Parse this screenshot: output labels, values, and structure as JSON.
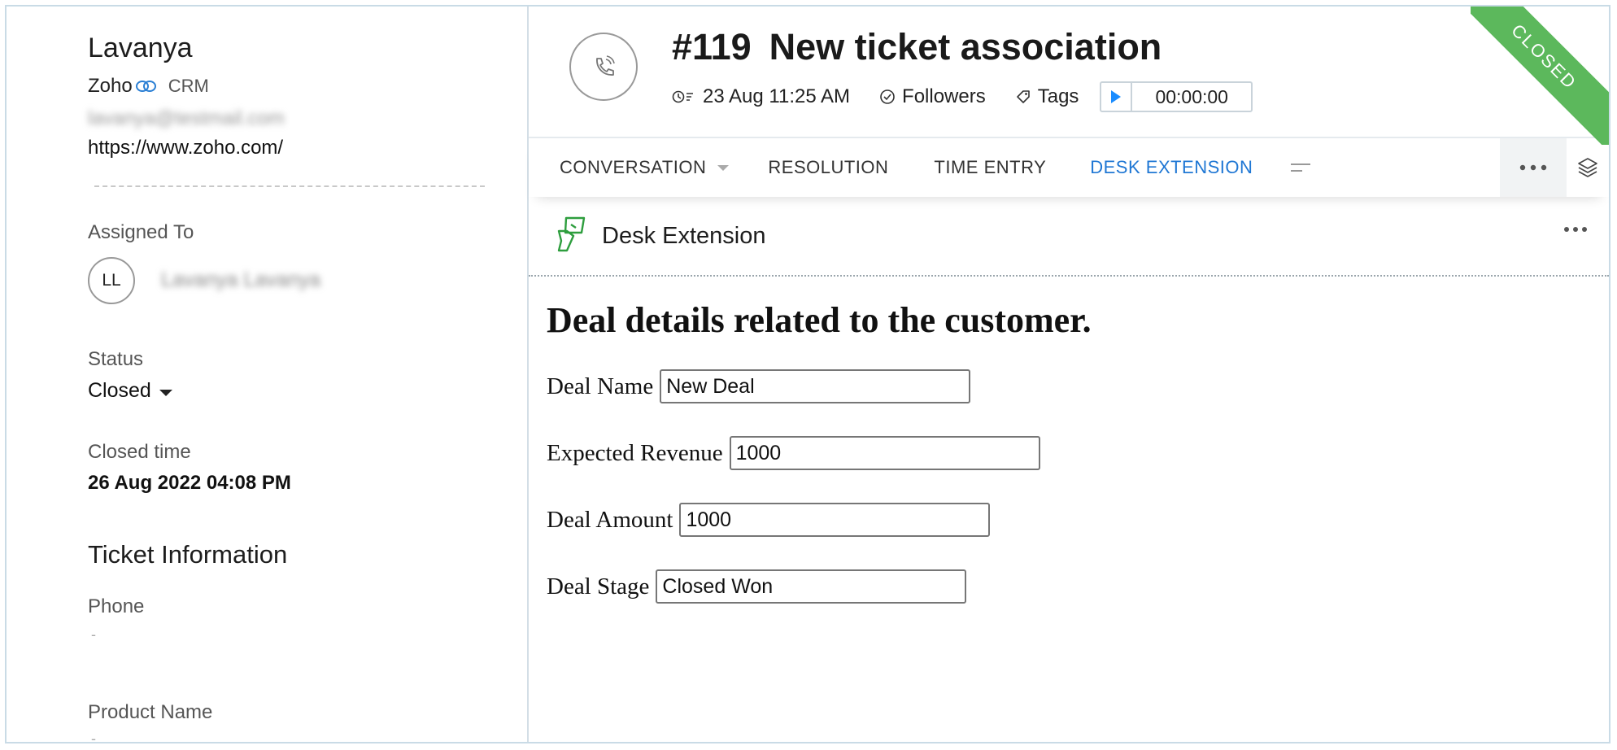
{
  "contact": {
    "name": "Lavanya",
    "company": "Zoho",
    "crm_label": "CRM",
    "email": "lavanya@testmail.com",
    "website": "https://www.zoho.com/"
  },
  "assigned": {
    "label": "Assigned To",
    "initials": "LL",
    "name": "Lavanya Lavanya"
  },
  "status": {
    "label": "Status",
    "value": "Closed"
  },
  "closed_time": {
    "label": "Closed time",
    "value": "26 Aug 2022 04:08 PM"
  },
  "ticket_info": {
    "title": "Ticket Information",
    "phone_label": "Phone",
    "phone_value": "-",
    "product_label": "Product Name",
    "product_value": "-"
  },
  "ticket": {
    "number": "#119",
    "title": "New ticket association",
    "datetime": "23 Aug 11:25 AM",
    "followers_label": "Followers",
    "tags_label": "Tags",
    "timer": "00:00:00",
    "ribbon": "CLOSED"
  },
  "tabs": [
    {
      "label": "CONVERSATION"
    },
    {
      "label": "RESOLUTION"
    },
    {
      "label": "TIME ENTRY"
    },
    {
      "label": "DESK EXTENSION"
    }
  ],
  "extension": {
    "title": "Desk Extension",
    "heading": "Deal details related to the customer.",
    "fields": [
      {
        "label": "Deal Name",
        "value": "New Deal"
      },
      {
        "label": "Expected Revenue",
        "value": "1000"
      },
      {
        "label": "Deal Amount",
        "value": "1000"
      },
      {
        "label": "Deal Stage",
        "value": "Closed Won"
      }
    ]
  },
  "colors": {
    "accent": "#1f77d4",
    "ribbon": "#5cb85c",
    "extension_icon": "#2e9e3e"
  }
}
